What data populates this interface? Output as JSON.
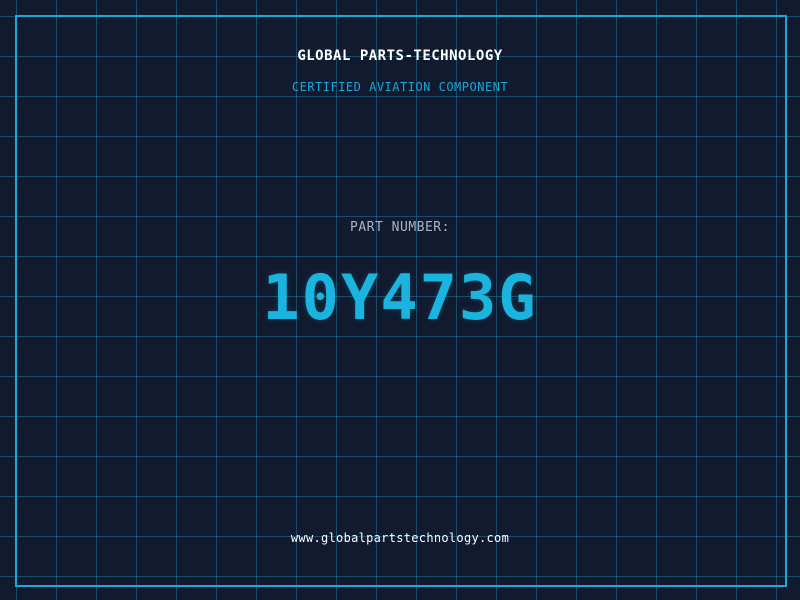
{
  "header": {
    "company_name": "GLOBAL PARTS-TECHNOLOGY",
    "subtitle": "CERTIFIED AVIATION COMPONENT"
  },
  "part": {
    "label": "PART NUMBER:",
    "number": "10Y473G"
  },
  "footer": {
    "website": "www.globalpartstechnology.com"
  },
  "colors": {
    "background": "#111a2e",
    "grid": "#20789a",
    "accent": "#1aa8d8",
    "text": "#ffffff",
    "muted": "#a9b5c6"
  }
}
